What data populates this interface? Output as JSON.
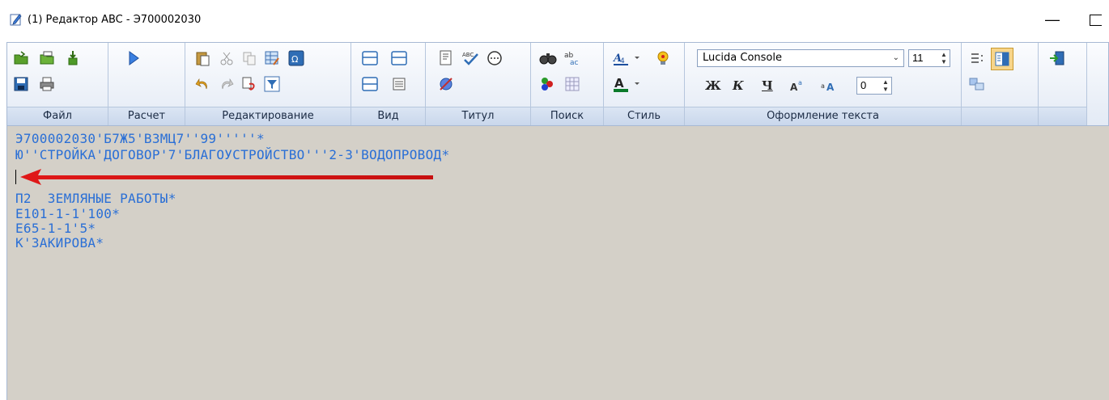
{
  "window": {
    "title": "(1) Редактор ABC - Э700002030",
    "minimize_glyph": "—"
  },
  "ribbon": {
    "groups": [
      {
        "label": "Файл"
      },
      {
        "label": "Расчет"
      },
      {
        "label": "Редактирование"
      },
      {
        "label": "Вид"
      },
      {
        "label": "Титул"
      },
      {
        "label": "Поиск"
      },
      {
        "label": "Стиль"
      },
      {
        "label": "Оформление текста"
      }
    ],
    "font_name": "Lucida Console",
    "font_size": "11",
    "spacing_value": "0",
    "format_bold": "Ж",
    "format_italic": "К",
    "format_underline": "Ч"
  },
  "editor": {
    "lines": [
      "Э700002030'Б7Ж5'В3МЦ7''99'''''*",
      "Ю''СТРОЙКА'ДОГОВОР'7'БЛАГОУСТРОЙСТВО'''2-3'ВОДОПРОВОД*",
      "",
      "П2  ЗЕМЛЯНЫЕ РАБОТЫ*",
      "Е101-1-1'100*",
      "Е65-1-1'5*",
      "К'ЗАКИРОВА*"
    ]
  },
  "colors": {
    "text": "#2a6fd6",
    "editor_bg": "#d4d0c8",
    "arrow": "#e02020"
  }
}
